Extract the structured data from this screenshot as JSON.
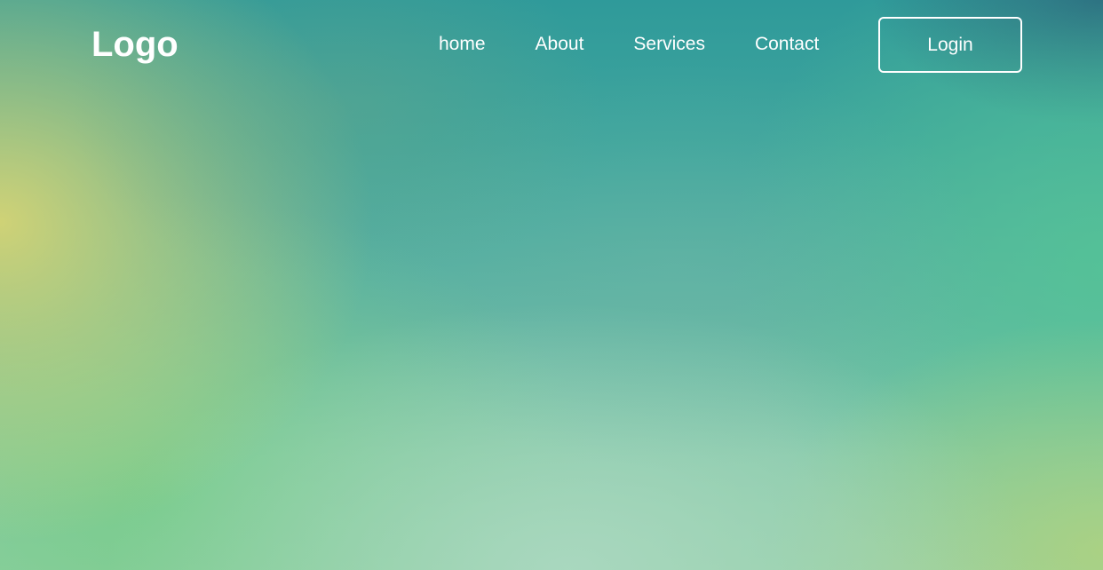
{
  "header": {
    "logo": "Logo",
    "nav": {
      "home": "home",
      "about": "About",
      "services": "Services",
      "contact": "Contact"
    },
    "login_label": "Login"
  },
  "colors": {
    "text": "#ffffff",
    "top_right": "#22567a",
    "top": "#2f9a9a",
    "left_glow": "#d6d474",
    "bottom_center": "#aad8c0",
    "bottom_left": "#78cc8a",
    "right_green": "#54c496"
  }
}
